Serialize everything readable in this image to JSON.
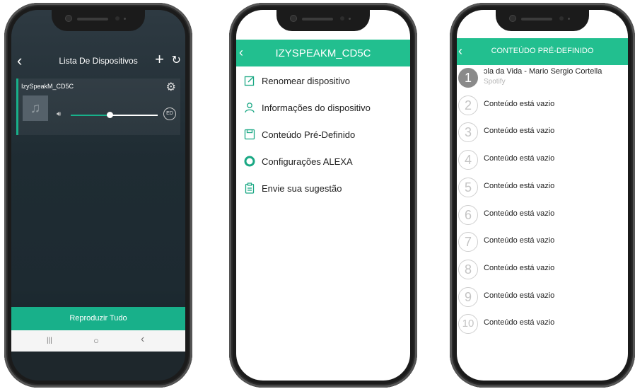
{
  "phone1": {
    "header": {
      "back": "‹",
      "title": "Lista De Dispositivos",
      "add": "+",
      "refresh": "↻"
    },
    "device": {
      "name": "IzySpeakM_CD5C",
      "volume_percent": 45,
      "ed_label": "ED"
    },
    "play_all": "Reproduzir Tudo",
    "nav": {
      "recent": "|||",
      "home": "○",
      "back": "‹"
    }
  },
  "phone2": {
    "header": {
      "back": "‹",
      "title": "IZYSPEAKM_CD5C"
    },
    "menu": [
      {
        "icon": "edit-icon",
        "label": "Renomear dispositivo"
      },
      {
        "icon": "user-icon",
        "label": "Informações do dispositivo"
      },
      {
        "icon": "save-icon",
        "label": "Conteúdo Pré-Definido"
      },
      {
        "icon": "alexa-icon",
        "label": "Configurações ALEXA"
      },
      {
        "icon": "clipboard-icon",
        "label": "Envie sua sugestão"
      }
    ]
  },
  "phone3": {
    "header": {
      "back": "‹",
      "title": "CONTEÚDO PRÉ-DEFINIDO"
    },
    "presets": [
      {
        "num": "1",
        "label": "ɔla da Vida - Mario Sergio Cortella",
        "sub": "Spotify",
        "filled": true
      },
      {
        "num": "2",
        "label": "Conteúdo está vazio"
      },
      {
        "num": "3",
        "label": "Conteúdo está vazio"
      },
      {
        "num": "4",
        "label": "Conteúdo está vazio"
      },
      {
        "num": "5",
        "label": "Conteúdo está vazio"
      },
      {
        "num": "6",
        "label": "Conteúdo está vazio"
      },
      {
        "num": "7",
        "label": "Conteúdo está vazio"
      },
      {
        "num": "8",
        "label": "Conteúdo está vazio"
      },
      {
        "num": "9",
        "label": "Conteúdo está vazio"
      },
      {
        "num": "10",
        "label": "Conteúdo está vazio"
      }
    ]
  },
  "colors": {
    "accent": "#22bf8f",
    "dark_bg": "#1f2c33"
  }
}
